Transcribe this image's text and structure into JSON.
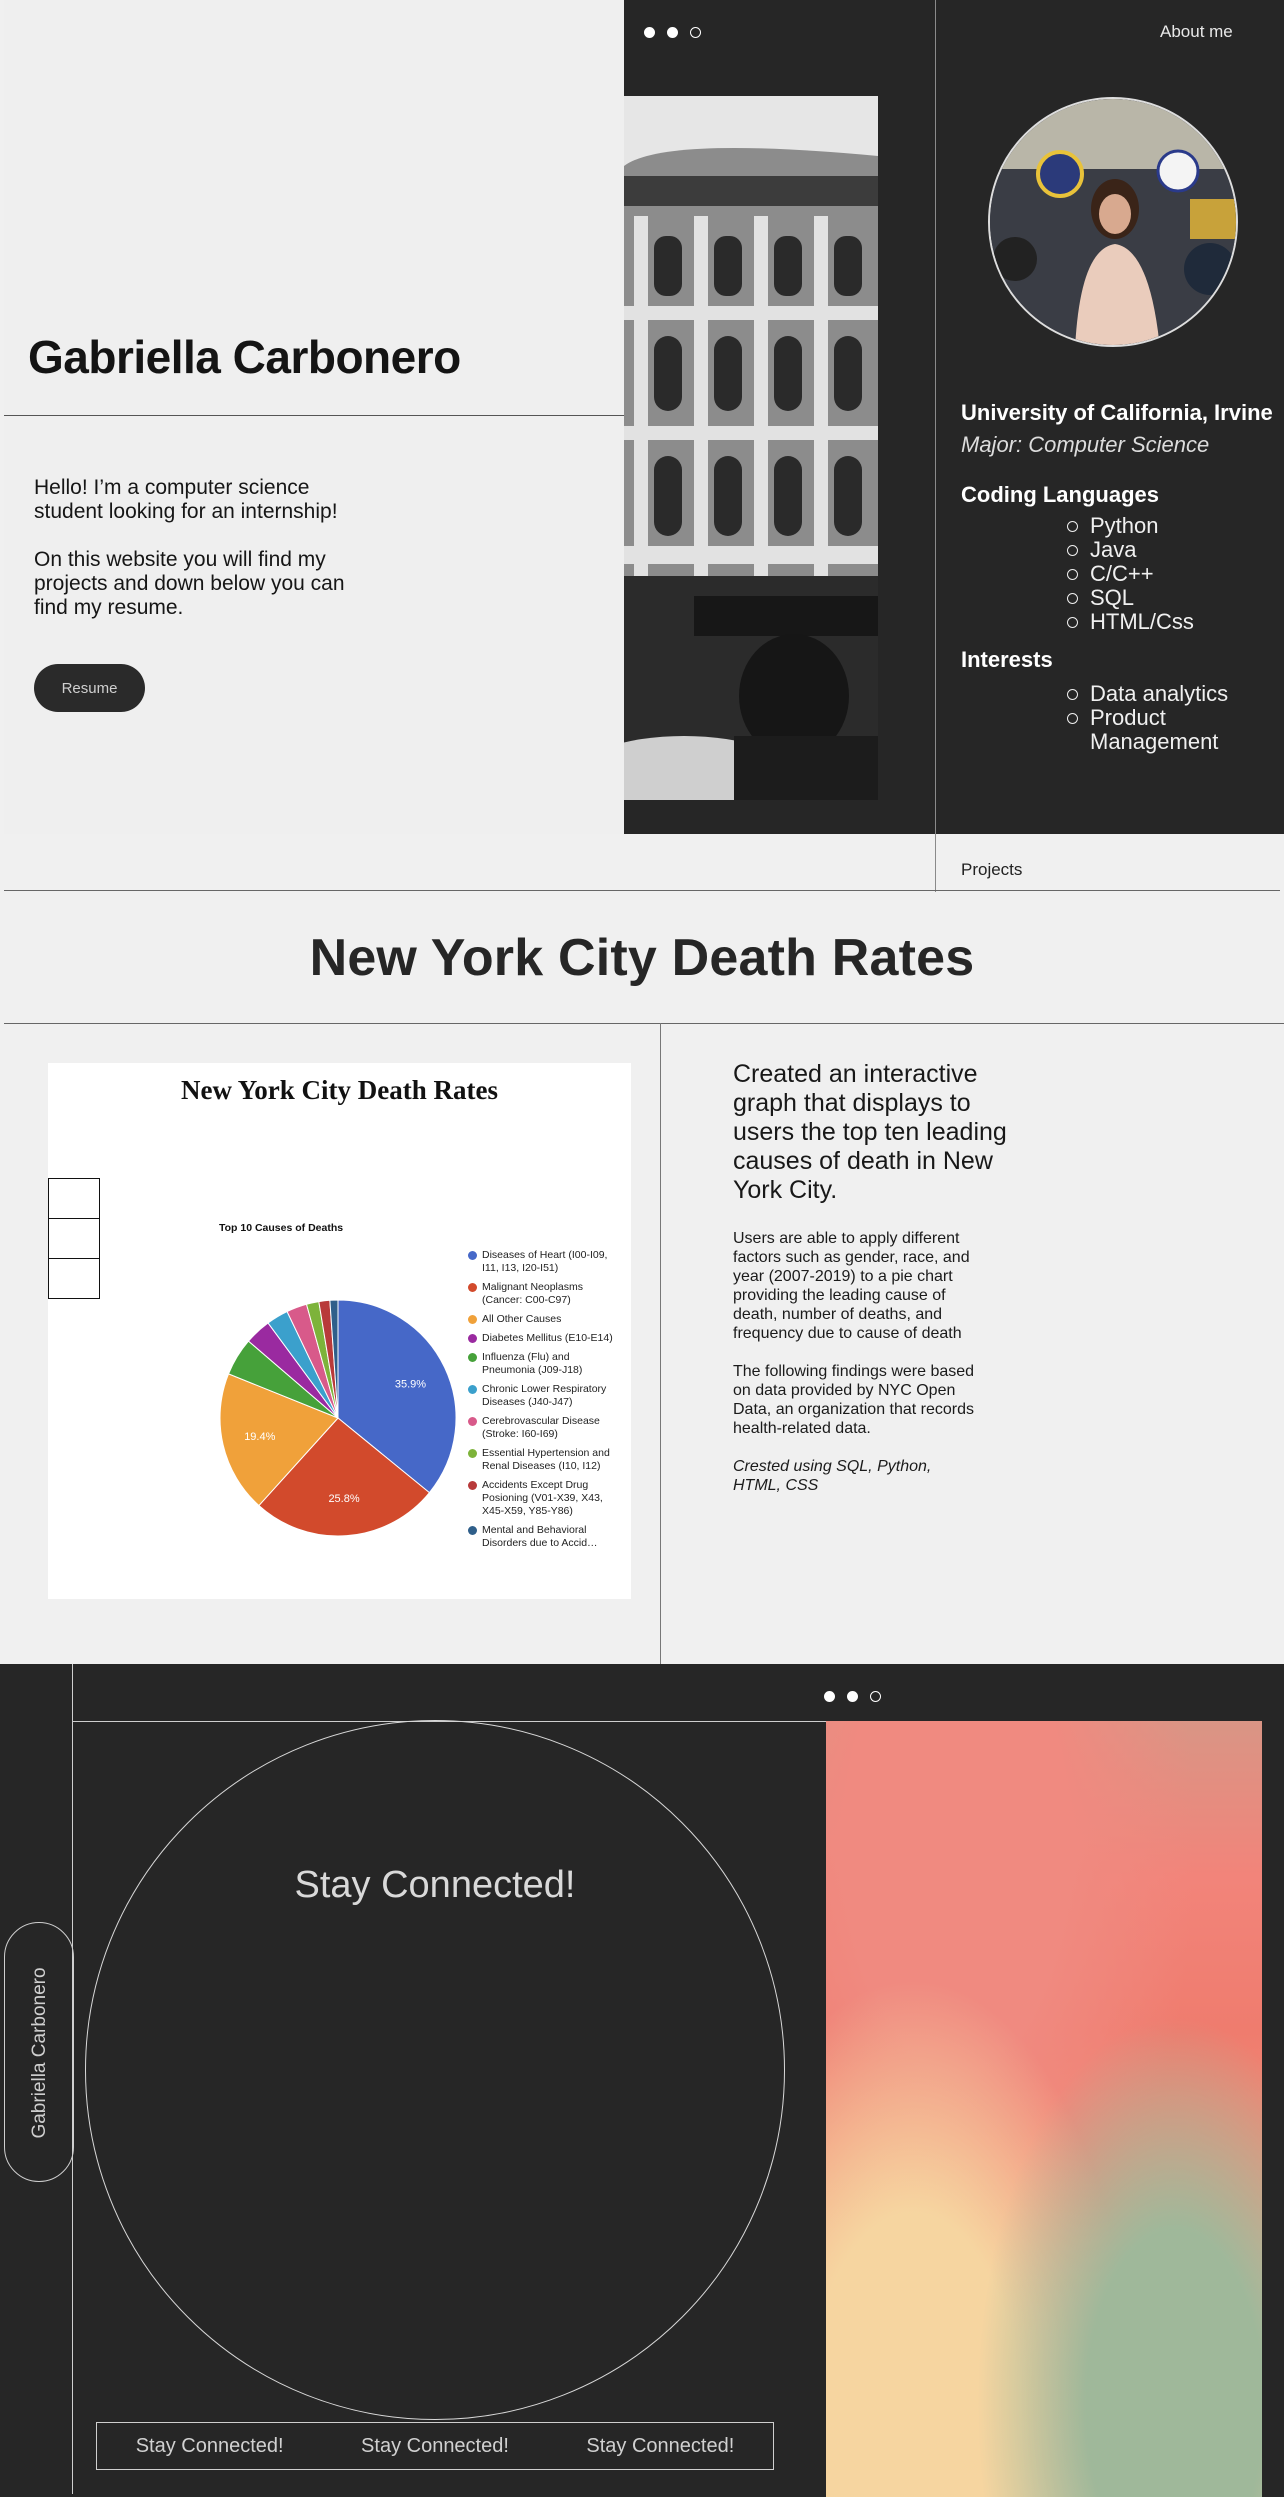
{
  "hero": {
    "name": "Gabriella Carbonero",
    "intro_1": "Hello! I’m a computer science student looking for an internship!",
    "intro_2": "On this website you will find my projects and down below you can find my resume.",
    "resume_label": "Resume"
  },
  "nav": {
    "about_label": "About me",
    "projects_label": "Projects"
  },
  "profile": {
    "university": "University of California, Irvine",
    "major": "Major: Computer Science",
    "languages_heading": "Coding Languages",
    "languages": [
      "Python",
      "Java",
      "C/C++",
      "SQL",
      "HTML/Css"
    ],
    "interests_heading": "Interests",
    "interests": [
      "Data analytics",
      "Product Management"
    ]
  },
  "project": {
    "section_title": "New York City Death Rates",
    "headline": "Created an interactive graph that displays to users the top ten leading causes of death in New York City.",
    "body_1": "Users are able to apply different factors such as gender, race, and year (2007-2019) to a pie chart providing the leading cause of death, number of deaths, and frequency due to cause of death",
    "body_2": "The following findings were based on data provided by NYC Open Data, an organization that records health-related data.",
    "credits": "Crested using SQL, Python, HTML, CSS"
  },
  "chart_data": {
    "type": "pie",
    "title": "New York City Death Rates",
    "subtitle": "Top 10 Causes of Deaths",
    "legend_position": "right",
    "slices": [
      {
        "label": "Diseases of Heart (I00-I09, I11, I13, I20-I51)",
        "value": 35.9,
        "color": "#4668c8",
        "show_label": "35.9%"
      },
      {
        "label": "Malignant Neoplasms (Cancer: C00-C97)",
        "value": 25.8,
        "color": "#d24a2c",
        "show_label": "25.8%"
      },
      {
        "label": "All Other Causes",
        "value": 19.4,
        "color": "#f0a13a",
        "show_label": "19.4%"
      },
      {
        "label": "Influenza (Flu) and Pneumonia (J09-J18)",
        "value": 5.2,
        "color": "#46a13a",
        "show_label": ""
      },
      {
        "label": "Diabetes Mellitus (E10-E14)",
        "value": 3.6,
        "color": "#9a2aa0",
        "show_label": ""
      },
      {
        "label": "Chronic Lower Respiratory Diseases (J40-J47)",
        "value": 3.0,
        "color": "#3ba0cc",
        "show_label": ""
      },
      {
        "label": "Cerebrovascular Disease (Stroke: I60-I69)",
        "value": 2.8,
        "color": "#d85a8a",
        "show_label": ""
      },
      {
        "label": "Essential Hypertension and Renal Diseases (I10, I12)",
        "value": 1.7,
        "color": "#7db33a",
        "show_label": ""
      },
      {
        "label": "Accidents Except Drug Posioning (V01-X39, X43, X45-X59, Y85-Y86)",
        "value": 1.5,
        "color": "#b83a3a",
        "show_label": ""
      },
      {
        "label": "Mental and Behavioral Disorders due to Accid…",
        "value": 1.1,
        "color": "#2f5f8a",
        "show_label": ""
      }
    ],
    "legend_labels": [
      "Diseases of Heart (I00-I09, I11, I13, I20-I51)",
      "Malignant Neoplasms (Cancer: C00-C97)",
      "All Other Causes",
      "Diabetes Mellitus (E10-E14)",
      "Influenza (Flu) and Pneumonia (J09-J18)",
      "Chronic Lower Respiratory Diseases (J40-J47)",
      "Cerebrovascular Disease (Stroke: I60-I69)",
      "Essential Hypertension and Renal Diseases (I10, I12)",
      "Accidents Except Drug Posioning (V01-X39, X43, X45-X59, Y85-Y86)",
      "Mental and Behavioral Disorders due to Accid…"
    ],
    "legend_colors": [
      "#4668c8",
      "#d24a2c",
      "#f0a13a",
      "#9a2aa0",
      "#46a13a",
      "#3ba0cc",
      "#d85a8a",
      "#7db33a",
      "#b83a3a",
      "#2f5f8a"
    ]
  },
  "footer": {
    "stay_connected": "Stay Connected!",
    "side_name": "Gabriella Carbonero",
    "bar_items": [
      "Stay Connected!",
      "Stay Connected!",
      "Stay Connected!"
    ]
  },
  "icons": {
    "slider_dots": [
      "dot-filled-icon",
      "dot-filled-icon",
      "dot-empty-icon"
    ]
  },
  "colors": {
    "dark": "#262626",
    "light": "#efefef"
  }
}
